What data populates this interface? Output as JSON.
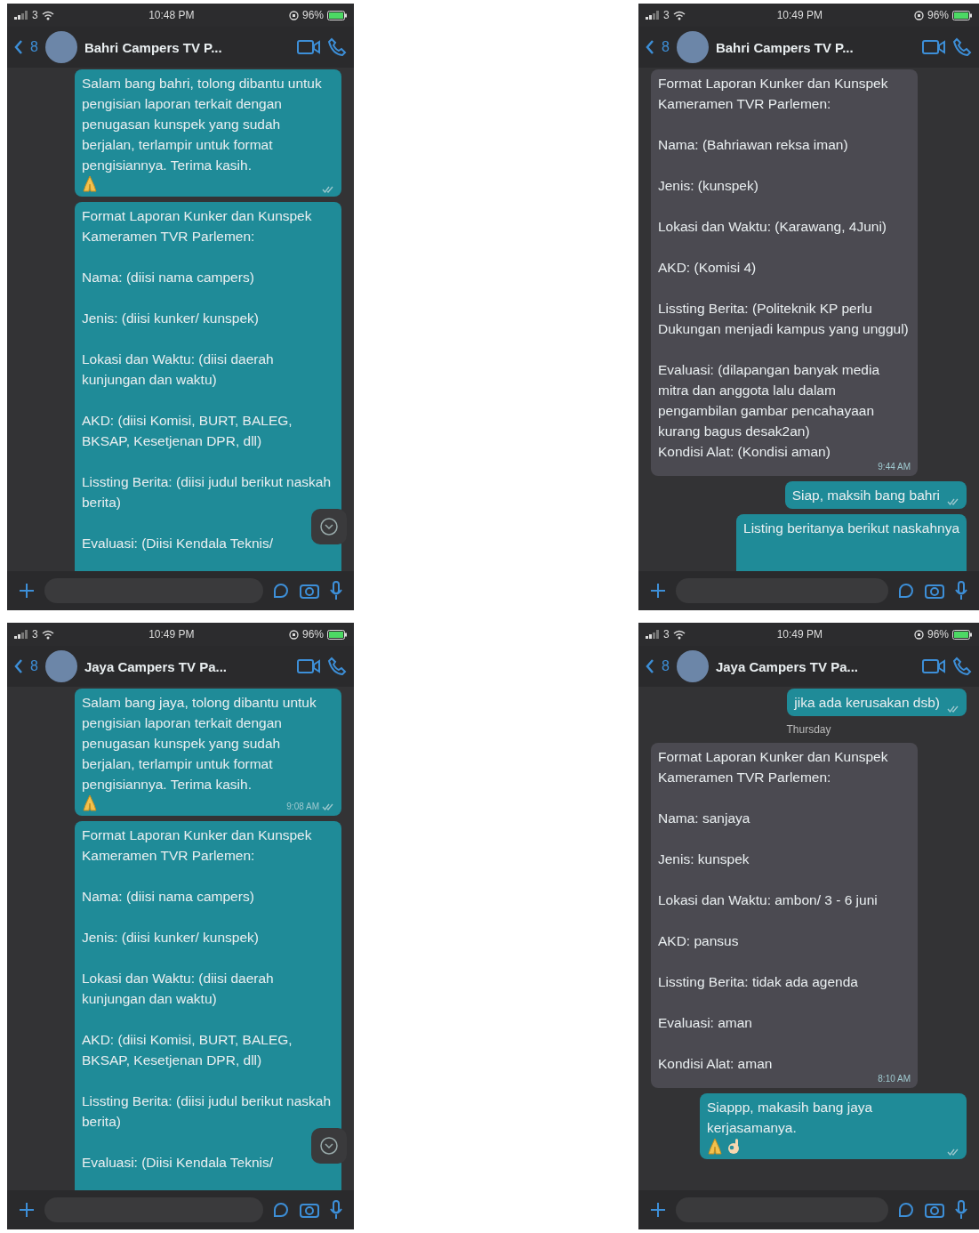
{
  "phones": [
    {
      "status": {
        "carrier": "3",
        "time": "10:48 PM",
        "battery": "96%"
      },
      "chat": {
        "back_count": "8",
        "title": "Bahri Campers TV P..."
      },
      "scroll_down_button": true,
      "messages": [
        {
          "kind": "out",
          "text": "Salam bang bahri, tolong dibantu untuk pengisian laporan terkait dengan penugasan kunspek yang sudah berjalan, terlampir untuk format pengisiannya. Terima kasih.",
          "emoji": [
            {
              "kind": "folded-hands"
            }
          ]
        },
        {
          "kind": "out",
          "text": "Format Laporan Kunker dan Kunspek Kameramen TVR Parlemen:\n\nNama: (diisi nama campers)\n\nJenis: (diisi kunker/ kunspek)\n\nLokasi dan Waktu: (diisi daerah kunjungan dan waktu)\n\nAKD: (diisi Komisi, BURT, BALEG, BKSAP, Kesetjenan DPR, dll)\n\nLissting Berita: (diisi judul berikut naskah berita)\n\nEvaluasi: (Diisi Kendala Teknis/",
          "cut": true
        }
      ]
    },
    {
      "status": {
        "carrier": "3",
        "time": "10:49 PM",
        "battery": "96%"
      },
      "chat": {
        "back_count": "8",
        "title": "Bahri Campers TV P..."
      },
      "scroll_down_button": false,
      "messages": [
        {
          "kind": "in",
          "text": "Format Laporan Kunker dan Kunspek Kameramen TVR Parlemen:\n\nNama: (Bahriawan reksa iman)\n\nJenis: (kunspek)\n\nLokasi dan Waktu: (Karawang, 4Juni)\n\nAKD: (Komisi 4)\n\nLissting Berita: (Politeknik KP perlu Dukungan menjadi kampus yang unggul)\n\nEvaluasi: (dilapangan banyak media mitra dan anggota lalu dalam pengambilan gambar pencahayaan kurang bagus desak2an)\nKondisi Alat: (Kondisi aman)",
          "time": "9:44 AM"
        },
        {
          "kind": "out",
          "text": "Siap, maksih bang bahri"
        },
        {
          "kind": "out",
          "text": "Listing beritanya berikut naskahnya",
          "cut": true
        }
      ]
    },
    {
      "status": {
        "carrier": "3",
        "time": "10:49 PM",
        "battery": "96%"
      },
      "chat": {
        "back_count": "8",
        "title": "Jaya Campers TV Pa..."
      },
      "scroll_down_button": true,
      "messages": [
        {
          "kind": "out",
          "text": "Salam bang jaya, tolong dibantu untuk pengisian laporan terkait dengan penugasan kunspek yang sudah berjalan, terlampir untuk format pengisiannya. Terima kasih.",
          "emoji": [
            {
              "kind": "folded-hands"
            }
          ],
          "time": "9:08 AM"
        },
        {
          "kind": "out",
          "text": "Format Laporan Kunker dan Kunspek Kameramen TVR Parlemen:\n\nNama: (diisi nama campers)\n\nJenis: (diisi kunker/ kunspek)\n\nLokasi dan Waktu: (diisi daerah kunjungan dan waktu)\n\nAKD: (diisi Komisi, BURT, BALEG, BKSAP, Kesetjenan DPR, dll)\n\nLissting Berita: (diisi judul berikut naskah berita)\n\nEvaluasi: (Diisi Kendala Teknis/",
          "cut": true
        }
      ]
    },
    {
      "status": {
        "carrier": "3",
        "time": "10:49 PM",
        "battery": "96%"
      },
      "chat": {
        "back_count": "8",
        "title": "Jaya Campers TV Pa..."
      },
      "scroll_down_button": false,
      "messages": [
        {
          "kind": "out",
          "text": "jika ada kerusakan dsb)"
        },
        {
          "kind": "day",
          "text": "Thursday"
        },
        {
          "kind": "in",
          "text": "Format Laporan Kunker dan Kunspek Kameramen TVR Parlemen:\n\nNama: sanjaya\n\nJenis: kunspek\n\nLokasi dan Waktu: ambon/ 3 - 6 juni\n\nAKD: pansus\n\nLissting Berita: tidak ada agenda\n\nEvaluasi: aman\n\nKondisi Alat: aman",
          "time": "8:10 AM"
        },
        {
          "kind": "out",
          "text": "Siappp, makasih bang jaya kerjasamanya.",
          "emoji": [
            {
              "kind": "folded-hands"
            },
            {
              "kind": "ok-hand"
            }
          ]
        }
      ]
    }
  ]
}
